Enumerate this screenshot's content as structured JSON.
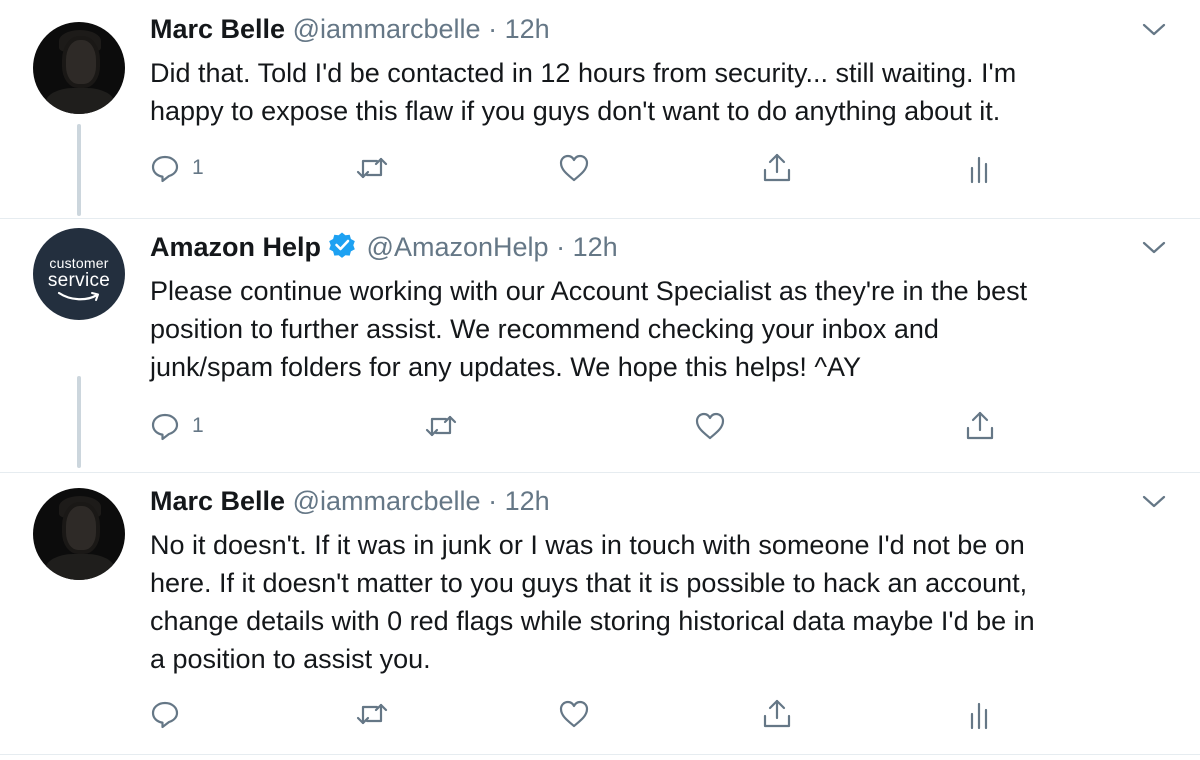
{
  "tweets": [
    {
      "name": "Marc Belle",
      "handle": "@iammarcbelle",
      "separator": "·",
      "time": "12h",
      "text_lines": [
        "Did that. Told I'd be contacted in 12 hours from security... still waiting. I'm",
        "happy to expose this flaw if you guys don't want to do anything about it."
      ],
      "reply_count": "1"
    },
    {
      "name": "Amazon Help",
      "handle": "@AmazonHelp",
      "separator": "·",
      "time": "12h",
      "avatar_text_1": "customer",
      "avatar_text_2": "service",
      "text_lines": [
        "Please continue working with our Account Specialist as they're in the best",
        "position to further assist. We recommend checking your inbox and",
        "junk/spam folders for any updates. We hope this helps! ^AY"
      ],
      "reply_count": "1"
    },
    {
      "name": "Marc Belle",
      "handle": "@iammarcbelle",
      "separator": "·",
      "time": "12h",
      "text_lines": [
        "No it doesn't. If it was in junk or I was in touch with someone I'd not be on",
        "here. If it doesn't matter to you guys that it is possible to hack an account,",
        "change details with 0 red flags while storing historical data maybe I'd be in",
        "a position to assist you."
      ],
      "reply_count": ""
    }
  ],
  "colors": {
    "text": "#14171a",
    "muted": "#657786",
    "verified": "#1da1f2",
    "thread_line": "#ccd6dd",
    "brand_bg": "#232f3e"
  },
  "icons": [
    "reply-icon",
    "retweet-icon",
    "like-icon",
    "share-icon",
    "analytics-icon",
    "chevron-down-icon",
    "verified-badge-icon"
  ]
}
